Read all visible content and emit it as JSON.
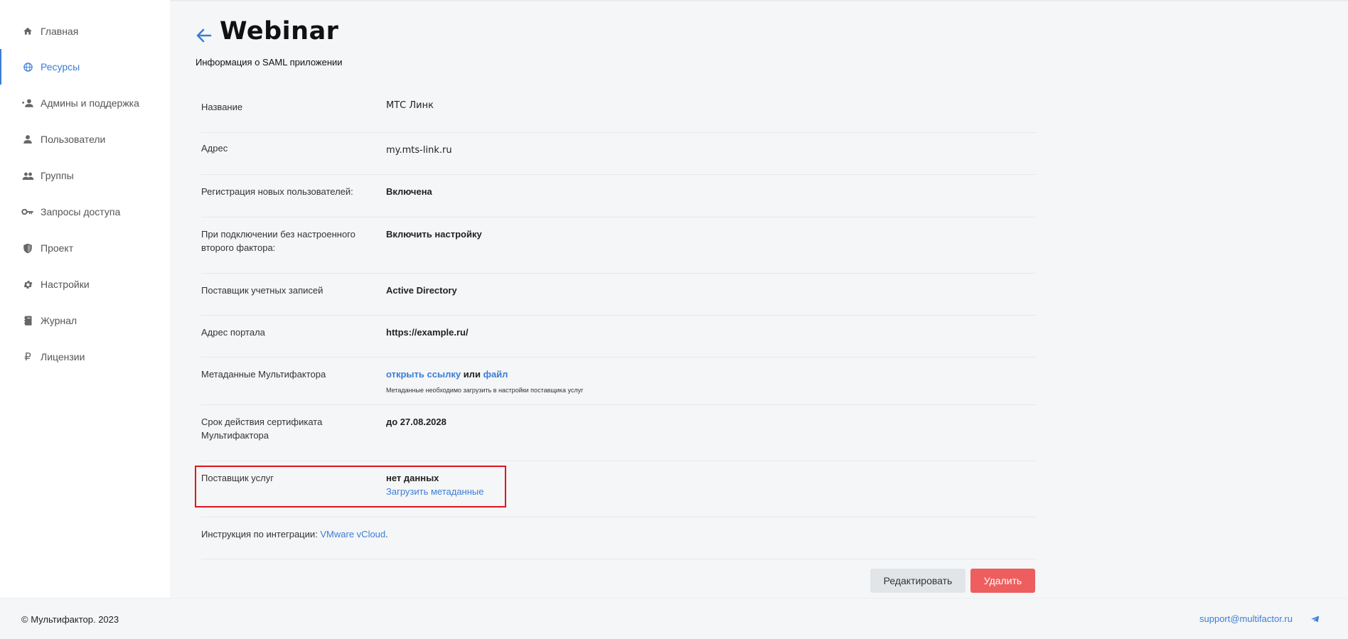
{
  "sidebar": {
    "items": [
      {
        "label": "Главная",
        "icon": "home-icon"
      },
      {
        "label": "Ресурсы",
        "icon": "globe-icon",
        "active": true
      },
      {
        "label": "Админы и поддержка",
        "icon": "admin-support-icon"
      },
      {
        "label": "Пользователи",
        "icon": "user-icon"
      },
      {
        "label": "Группы",
        "icon": "group-icon"
      },
      {
        "label": "Запросы доступа",
        "icon": "key-icon"
      },
      {
        "label": "Проект",
        "icon": "shield-icon"
      },
      {
        "label": "Настройки",
        "icon": "gear-icon"
      },
      {
        "label": "Журнал",
        "icon": "journal-icon"
      },
      {
        "label": "Лицензии",
        "icon": "ruble-icon"
      }
    ]
  },
  "header": {
    "title": "Webinar",
    "subtitle": "Информация о SAML приложении"
  },
  "details": {
    "name_label": "Название",
    "name_value": "МТС Линк",
    "address_label": "Адрес",
    "address_value": "my.mts-link.ru",
    "registration_label": "Регистрация новых пользователей:",
    "registration_value": "Включена",
    "no_second_factor_label": "При подключении без настроенного второго фактора:",
    "no_second_factor_value": "Включить настройку",
    "provider_label": "Поставщик учетных записей",
    "provider_value": "Active Directory",
    "portal_label": "Адрес портала",
    "portal_value": "https://example.ru/",
    "metadata_label": "Метаданные Мультифактора",
    "metadata_open_link": "открыть ссылку",
    "metadata_or": "или",
    "metadata_file_link": "файл",
    "metadata_note": "Метаданные необходимо загрузить в настройки поставщика услуг",
    "cert_label": "Срок действия сертификата Мультифактора",
    "cert_value": "до 27.08.2028",
    "sp_label": "Поставщик услуг",
    "sp_value": "нет данных",
    "sp_upload_link": "Загрузить метаданные",
    "integration_label": "Инструкция по интеграции:",
    "integration_link": "VMware vCloud",
    "integration_dot": "."
  },
  "actions": {
    "edit_label": "Редактировать",
    "delete_label": "Удалить"
  },
  "footer": {
    "copyright": "© Мультифактор. 2023",
    "support_email": "support@multifactor.ru"
  },
  "colors": {
    "accent": "#3b7dd8",
    "danger": "#ee5e5e",
    "highlight": "#e0141e"
  }
}
